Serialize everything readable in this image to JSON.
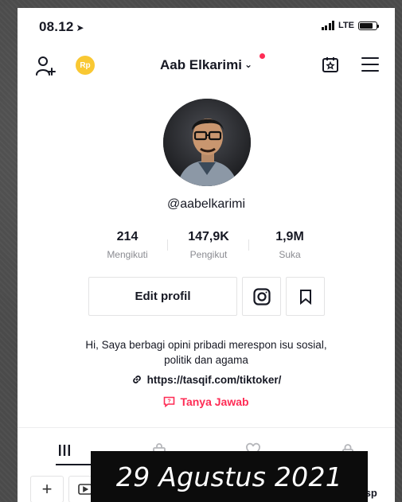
{
  "status_bar": {
    "time": "08.12",
    "network": "LTE"
  },
  "nav": {
    "coin_label": "Rp",
    "username": "Aab Elkarimi"
  },
  "profile": {
    "handle": "@aabelkarimi",
    "stats": [
      {
        "value": "214",
        "label": "Mengikuti"
      },
      {
        "value": "147,9K",
        "label": "Pengikut"
      },
      {
        "value": "1,9M",
        "label": "Suka"
      }
    ],
    "edit_label": "Edit profil",
    "bio_line1": "Hi, Saya berbagi opini pribadi merespon isu sosial,",
    "bio_line2": "politik dan agama",
    "link": "https://tasqif.com/tiktoker/",
    "qa_label": "Tanya Jawab"
  },
  "subrow": {
    "partial_label": "Resp"
  },
  "overlay": {
    "date": "29 Agustus 2021"
  },
  "colors": {
    "accent": "#fe2c55",
    "coin": "#f9c833",
    "text": "#161823"
  }
}
